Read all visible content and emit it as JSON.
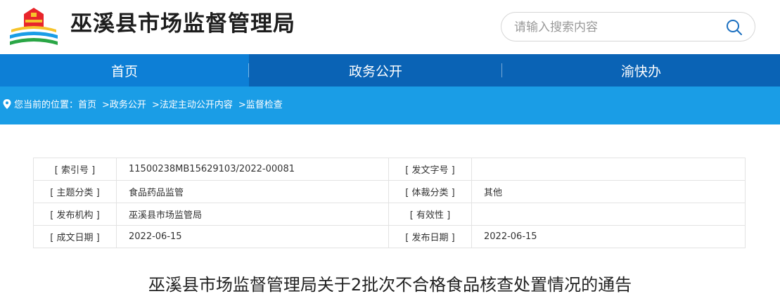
{
  "site": {
    "title": "巫溪县市场监督管理局"
  },
  "search": {
    "placeholder": "请输入搜索内容"
  },
  "nav": {
    "items": [
      {
        "label": "首页"
      },
      {
        "label": "政务公开"
      },
      {
        "label": "渝快办"
      }
    ]
  },
  "breadcrumb": {
    "prefix": "您当前的位置：",
    "items": [
      "首页",
      ">政务公开",
      ">法定主动公开内容",
      ">监督检查"
    ]
  },
  "meta": {
    "rows": [
      {
        "l1": "[ 索引号 ]",
        "v1": "11500238MB15629103/2022-00081",
        "l2": "[ 发文字号 ]",
        "v2": ""
      },
      {
        "l1": "[ 主题分类 ]",
        "v1": "食品药品监管",
        "l2": "[ 体裁分类 ]",
        "v2": "其他"
      },
      {
        "l1": "[ 发布机构 ]",
        "v1": "巫溪县市场监管局",
        "l2": "[ 有效性 ]",
        "v2": ""
      },
      {
        "l1": "[ 成文日期 ]",
        "v1": "2022-06-15",
        "l2": "[ 发布日期 ]",
        "v2": "2022-06-15"
      }
    ]
  },
  "document": {
    "title": "巫溪县市场监督管理局关于2批次不合格食品核查处置情况的通告"
  },
  "colors": {
    "nav": "#0a63b5",
    "nav_active": "#0d7fd6",
    "breadcrumb_bar": "#1a9de6"
  },
  "icons": {
    "logo": "emblem-logo",
    "search": "search-icon",
    "location": "location-pin-icon"
  }
}
